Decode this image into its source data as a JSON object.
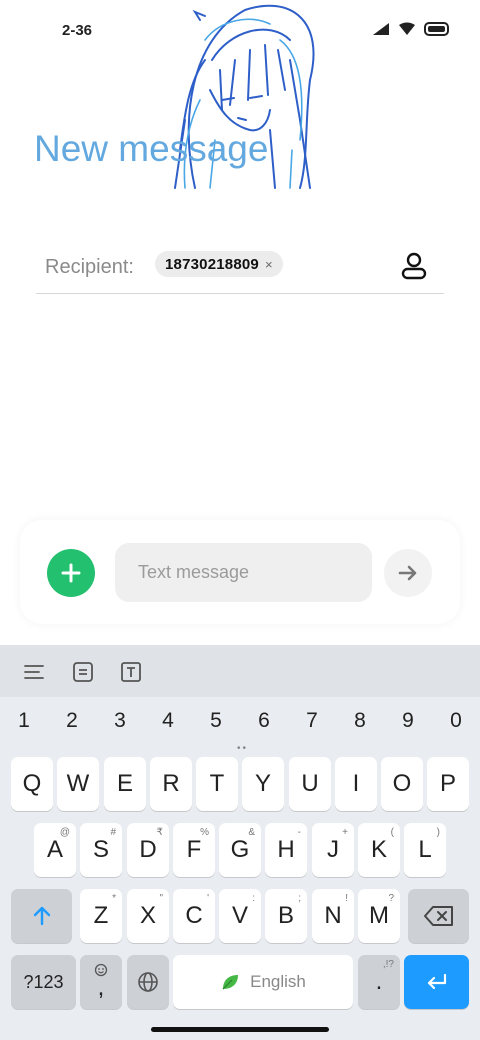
{
  "status_bar": {
    "time": "2-36"
  },
  "header": {
    "title": "New message"
  },
  "recipient": {
    "label": "Recipient:",
    "chip_number": "18730218809",
    "chip_close": "×"
  },
  "composer": {
    "placeholder": "Text message"
  },
  "keyboard": {
    "numbers": [
      "1",
      "2",
      "3",
      "4",
      "5",
      "6",
      "7",
      "8",
      "9",
      "0"
    ],
    "row1": [
      "Q",
      "W",
      "E",
      "R",
      "T",
      "Y",
      "U",
      "I",
      "O",
      "P"
    ],
    "row2": [
      "A",
      "S",
      "D",
      "F",
      "G",
      "H",
      "J",
      "K",
      "L"
    ],
    "row2_sub": [
      "@",
      "#",
      "₹",
      "%",
      "&",
      "-",
      "+",
      "(",
      ")"
    ],
    "row3": [
      "Z",
      "X",
      "C",
      "V",
      "B",
      "N",
      "M"
    ],
    "row3_sub": [
      "*",
      "\"",
      "'",
      ":",
      ";",
      "!",
      "?"
    ],
    "symbols_label": "?123",
    "comma_label": ",",
    "space_label": "English",
    "period_label": ".",
    "period_sub": ",!?"
  },
  "colors": {
    "accent_blue": "#1e9bff",
    "add_green": "#22c06f",
    "title_blue": "#63a9df"
  }
}
